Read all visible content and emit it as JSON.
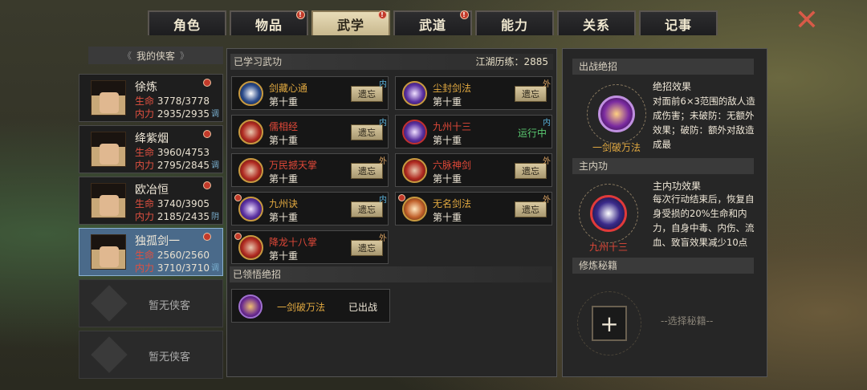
{
  "tabs": [
    {
      "label": "角色",
      "active": false,
      "alert": false
    },
    {
      "label": "物品",
      "active": false,
      "alert": true
    },
    {
      "label": "武学",
      "active": true,
      "alert": true
    },
    {
      "label": "武道",
      "active": false,
      "alert": true
    },
    {
      "label": "能力",
      "active": false,
      "alert": false
    },
    {
      "label": "关系",
      "active": false,
      "alert": false
    },
    {
      "label": "记事",
      "active": false,
      "alert": false
    }
  ],
  "close_icon": "close-x",
  "roster": {
    "title": "我的侠客",
    "characters": [
      {
        "name": "徐炼",
        "hp_label": "生命",
        "hp": "3778/3778",
        "mp_label": "内力",
        "mp": "2935/2935",
        "tag": "调"
      },
      {
        "name": "绛紫烟",
        "hp_label": "生命",
        "hp": "3960/4753",
        "mp_label": "内力",
        "mp": "2795/2845",
        "tag": "调"
      },
      {
        "name": "欧冶恒",
        "hp_label": "生命",
        "hp": "3740/3905",
        "mp_label": "内力",
        "mp": "2185/2435",
        "tag": "阴"
      },
      {
        "name": "独孤剑一",
        "hp_label": "生命",
        "hp": "2560/2560",
        "mp_label": "内力",
        "mp": "3710/3710",
        "tag": "调"
      }
    ],
    "empty_label": "暂无侠客"
  },
  "learned": {
    "title": "已学习武功",
    "exp_label": "江湖历练：2885",
    "skills": [
      {
        "name": "剑藏心通",
        "level": "第十重",
        "type": "内",
        "action": "遗忘",
        "color": "gold"
      },
      {
        "name": "尘封剑法",
        "level": "第十重",
        "type": "外",
        "action": "遗忘",
        "color": "gold"
      },
      {
        "name": "儒相经",
        "level": "第十重",
        "type": "内",
        "action": "遗忘",
        "color": "red"
      },
      {
        "name": "九州十三",
        "level": "第十重",
        "type": "内",
        "action": "运行中",
        "color": "red"
      },
      {
        "name": "万民撼天掌",
        "level": "第十重",
        "type": "外",
        "action": "遗忘",
        "color": "red"
      },
      {
        "name": "六脉神剑",
        "level": "第十重",
        "type": "外",
        "action": "遗忘",
        "color": "red"
      },
      {
        "name": "九州诀",
        "level": "第十重",
        "type": "内",
        "action": "遗忘",
        "color": "gold"
      },
      {
        "name": "无名剑法",
        "level": "第十重",
        "type": "外",
        "action": "遗忘",
        "color": "gold"
      },
      {
        "name": "降龙十八掌",
        "level": "第十重",
        "type": "外",
        "action": "遗忘",
        "color": "red"
      }
    ]
  },
  "ultimates": {
    "title": "已领悟绝招",
    "items": [
      {
        "name": "一剑破万法",
        "status": "已出战"
      }
    ]
  },
  "battle_ult": {
    "title": "出战绝招",
    "name": "一剑破万法",
    "effect_title": "绝招效果",
    "effect_text": "对面前6×3范围的敌人造成伤害；未破防：无额外效果；破防：额外对敌造成最"
  },
  "main_neigong": {
    "title": "主内功",
    "name": "九州十三",
    "effect_title": "主内功效果",
    "effect_text": "每次行动结束后，恢复自身受损的20%生命和内力，自身中毒、内伤、流血、致盲效果减少10点"
  },
  "cultivation": {
    "title": "修炼秘籍",
    "add_label": "+",
    "hint": "--选择秘籍--"
  }
}
